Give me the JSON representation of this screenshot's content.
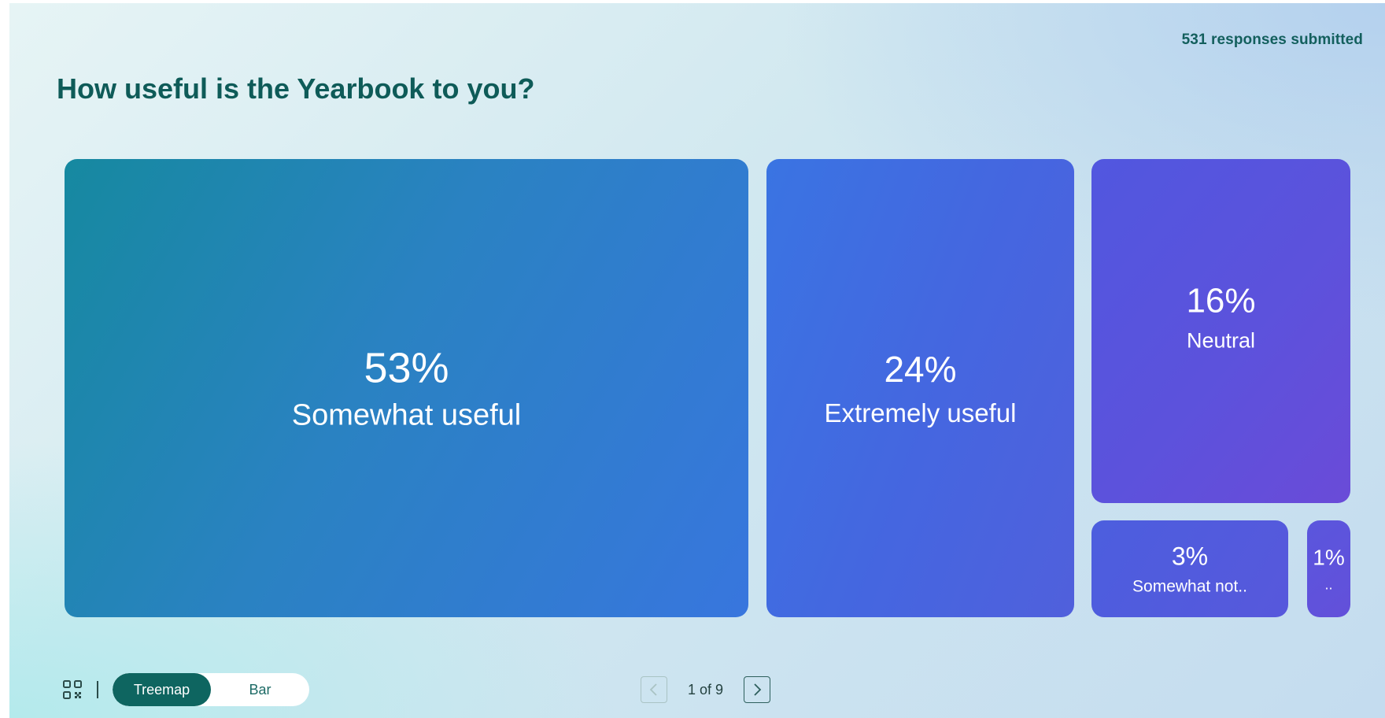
{
  "header": {
    "responses_text": "531 responses submitted",
    "question": "How useful is the Yearbook to you?"
  },
  "chart_data": {
    "type": "treemap",
    "tiles": [
      {
        "pct": "53%",
        "label": "Somewhat useful",
        "value": 53
      },
      {
        "pct": "24%",
        "label": "Extremely useful",
        "value": 24
      },
      {
        "pct": "16%",
        "label": "Neutral",
        "value": 16
      },
      {
        "pct": "3%",
        "label": "Somewhat not..",
        "value": 3
      },
      {
        "pct": "1%",
        "label": "..",
        "value": 1
      }
    ]
  },
  "footer": {
    "qr_icon": "qr-code-icon",
    "view_toggle": {
      "treemap_label": "Treemap",
      "bar_label": "Bar",
      "selected": "Treemap"
    },
    "pager": {
      "text": "1 of 9",
      "prev_icon": "chevron-left-icon",
      "next_icon": "chevron-right-icon"
    }
  },
  "colors": {
    "accent": "#0e6560",
    "title": "#0e5b58",
    "tile_text": "#ffffff"
  }
}
